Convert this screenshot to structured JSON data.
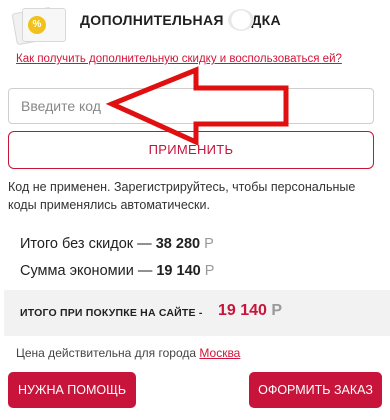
{
  "promo": {
    "title": "ДОПОЛНИТЕЛЬНАЯ СК ДКА",
    "badge": "%",
    "help_link": "Как получить дополнительную скидку и воспользоваться ей?"
  },
  "code_input": {
    "placeholder": "Введите код",
    "value": ""
  },
  "apply_button": "ПРИМЕНИТЬ",
  "status_message": "Код не применен. Зарегистрируйтесь, чтобы персональные коды применялись автоматически.",
  "totals": {
    "without_discount_label": "Итого без скидок —",
    "without_discount_value": "38 280",
    "savings_label": "Сумма экономии —",
    "savings_value": "19 140",
    "currency": "Р"
  },
  "final": {
    "label": "ИТОГО ПРИ ПОКУПКЕ НА САЙТЕ -",
    "value": "19 140",
    "currency": "Р"
  },
  "city": {
    "text": "Цена действительна для города",
    "link": "Москва"
  },
  "buttons": {
    "help": "НУЖНА ПОМОЩЬ",
    "order": "ОФОРМИТЬ ЗАКАЗ"
  },
  "colors": {
    "accent": "#c8143b",
    "annotation_arrow": "#e01010",
    "coupon_badge": "#f2c21a"
  },
  "icons": {
    "coupon": "coupon-icon",
    "annotation": "arrow-left-icon"
  }
}
